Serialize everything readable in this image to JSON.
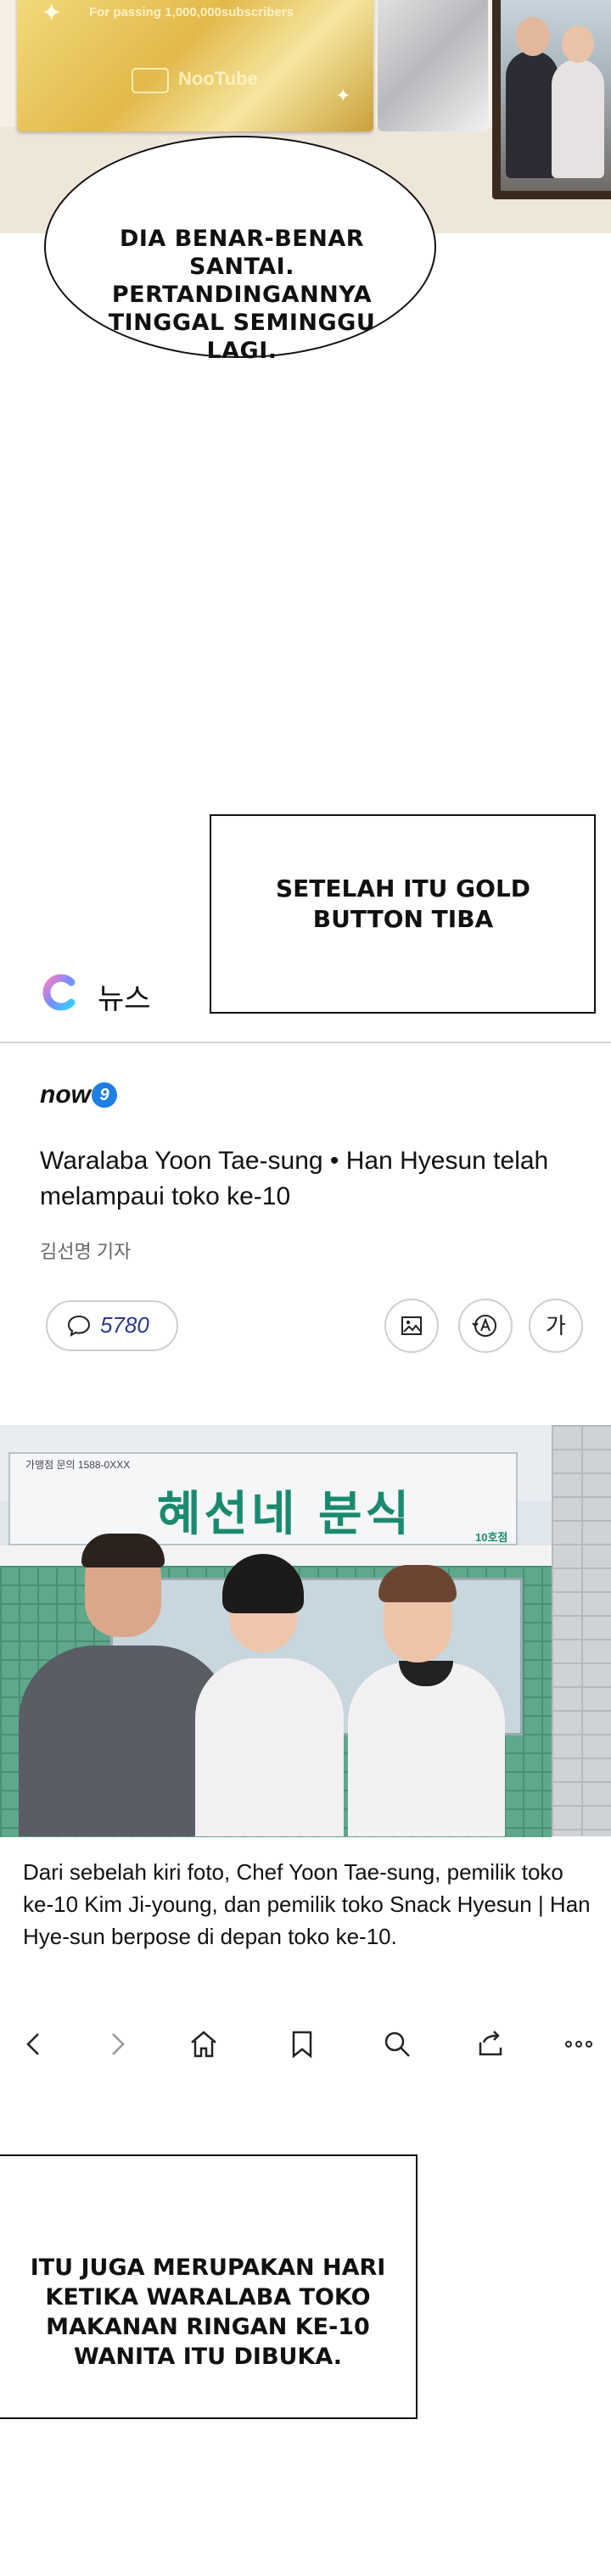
{
  "top_panel": {
    "plaque_text": "For passing 1,000,000subscribers",
    "plaque_logo": "NooTube",
    "speech_bubble": "DIA BENAR-BENAR SANTAI. PERTANDINGANNYA TINGGAL SEMINGGU LAGI."
  },
  "caption_1": "SETELAH ITU GOLD BUTTON TIBA",
  "news_app": {
    "app_icon": "c-logo-icon",
    "header_title": "뉴스",
    "brand": "now",
    "brand_badge": "9",
    "headline": "Waralaba Yoon Tae-sung • Han Hyesun telah melampaui toko ke-10",
    "reporter": "김선명 기자",
    "comment_count": "5780",
    "font_button_label": "가",
    "photo": {
      "store_name": "혜선네 분식",
      "store_sub": "가맹점 문의 1588-0XXX",
      "store_num": "10호점"
    },
    "photo_caption": "Dari sebelah kiri foto, Chef Yoon Tae-sung, pemilik toko ke-10 Kim Ji-young, dan pemilik toko Snack Hyesun | Han Hye-sun berpose di depan toko ke-10.",
    "nav_icons": [
      "back-icon",
      "forward-icon",
      "home-icon",
      "bookmark-icon",
      "search-icon",
      "share-icon",
      "more-icon"
    ]
  },
  "caption_2": "ITU JUGA MERUPAKAN HARI KETIKA WARALABA TOKO MAKANAN RINGAN KE-10 WANITA ITU DIBUKA.",
  "colors": {
    "brand_badge": "#1f7fe0",
    "store_sign_text": "#1a8a6e",
    "comment_count": "#2a3a8c"
  }
}
